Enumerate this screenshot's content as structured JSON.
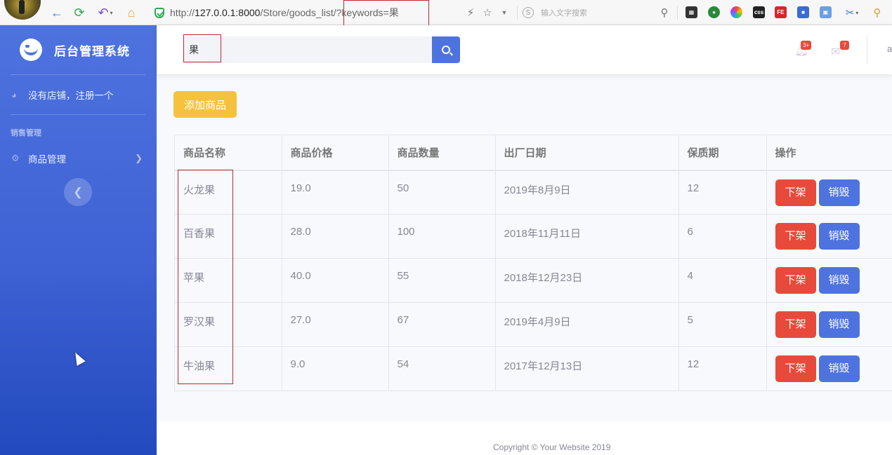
{
  "browser": {
    "url_prefix": "http://",
    "url_host": "127.0.0.1:8000",
    "url_path": "/Store/goods_list",
    "url_query": "/?keywords=果",
    "search_placeholder": "输入文字搜索",
    "search_logo": "S"
  },
  "sidebar": {
    "brand": "后台管理系统",
    "store_link": "没有店铺，注册一个",
    "heading": "销售管理",
    "goods_menu": "商品管理"
  },
  "topbar": {
    "search_value": "果",
    "alerts_badge": "3+",
    "messages_badge": "7",
    "user_initial": "a"
  },
  "main": {
    "add_button": "添加商品",
    "columns": [
      "商品名称",
      "商品价格",
      "商品数量",
      "出厂日期",
      "保质期",
      "操作"
    ],
    "rows": [
      {
        "name": "火龙果",
        "price": "19.0",
        "qty": "50",
        "date": "2019年8月9日",
        "shelf": "12"
      },
      {
        "name": "百香果",
        "price": "28.0",
        "qty": "100",
        "date": "2018年11月11日",
        "shelf": "6"
      },
      {
        "name": "苹果",
        "price": "40.0",
        "qty": "55",
        "date": "2018年12月23日",
        "shelf": "4"
      },
      {
        "name": "罗汉果",
        "price": "27.0",
        "qty": "67",
        "date": "2019年4月9日",
        "shelf": "5"
      },
      {
        "name": "牛油果",
        "price": "9.0",
        "qty": "54",
        "date": "2017年12月13日",
        "shelf": "12"
      }
    ],
    "off_label": "下架",
    "destroy_label": "销毁"
  },
  "footer": {
    "copyright": "Copyright © Your Website 2019"
  },
  "colors": {
    "primary": "#4e73df",
    "warning": "#f6c23e",
    "danger": "#e74a3b",
    "highlight": "#c1272d"
  }
}
